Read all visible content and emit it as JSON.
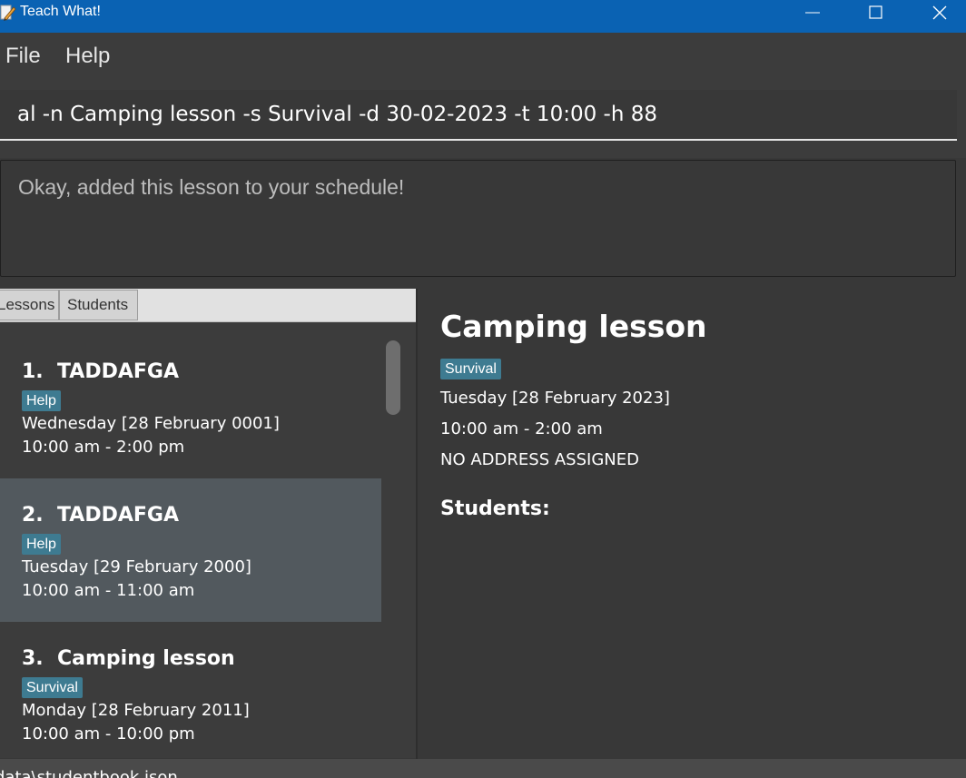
{
  "window": {
    "title": "Teach What!"
  },
  "menu": {
    "file": "File",
    "help": "Help"
  },
  "command": {
    "value": "al -n Camping lesson -s Survival -d 30-02-2023 -t 10:00 -h 88"
  },
  "result": {
    "message": "Okay, added this lesson to your schedule!"
  },
  "tabs": {
    "lessons": "Lessons",
    "students": "Students"
  },
  "lessons": [
    {
      "index": "1.",
      "name": "TADDAFGA",
      "tag": "Help",
      "date": "Wednesday [28 February 0001]",
      "time": "10:00 am - 2:00 pm"
    },
    {
      "index": "2.",
      "name": "TADDAFGA",
      "tag": "Help",
      "date": "Tuesday [29 February 2000]",
      "time": "10:00 am - 11:00 am",
      "selected": true
    },
    {
      "index": "3.",
      "name": "Camping lesson",
      "tag": "Survival",
      "date": "Monday [28 February 2011]",
      "time": "10:00 am - 10:00 pm"
    }
  ],
  "detail": {
    "title": "Camping lesson",
    "tag": "Survival",
    "date": "Tuesday [28 February 2023]",
    "time": "10:00 am - 2:00 am",
    "address": "NO ADDRESS ASSIGNED",
    "students_heading": "Students:"
  },
  "status": {
    "path": "data\\studentbook.json"
  },
  "icons": {
    "app": "pencil-icon",
    "minimize": "minimize-icon",
    "maximize": "maximize-icon",
    "close": "close-icon"
  },
  "colors": {
    "titlebar": "#0a62b3",
    "tag": "#3e7b91",
    "selected_card": "#52595e",
    "background": "#383838"
  }
}
